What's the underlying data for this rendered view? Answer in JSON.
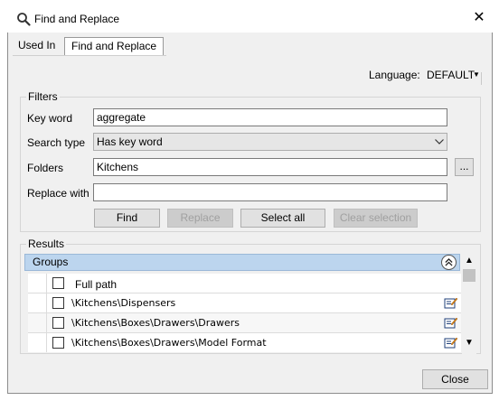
{
  "window": {
    "title": "Find and Replace",
    "close_glyph": "✕"
  },
  "tabs": [
    {
      "label": "Used In"
    },
    {
      "label": "Find and Replace"
    }
  ],
  "language": {
    "label": "Language:",
    "value": "DEFAULT"
  },
  "filters": {
    "group_label": "Filters",
    "key_word": {
      "label": "Key word",
      "value": "aggregate"
    },
    "search_type": {
      "label": "Search type",
      "value": "Has key word"
    },
    "folders": {
      "label": "Folders",
      "value": "Kitchens",
      "browse_label": "..."
    },
    "replace_with": {
      "label": "Replace with",
      "value": ""
    },
    "buttons": {
      "find": "Find",
      "replace": "Replace",
      "select_all": "Select all",
      "clear_selection": "Clear selection"
    }
  },
  "results": {
    "group_label": "Results",
    "grid_header": "Groups",
    "column_header": "Full path",
    "rows": [
      {
        "path": "\\Kitchens\\Dispensers"
      },
      {
        "path": "\\Kitchens\\Boxes\\Drawers\\Drawers"
      },
      {
        "path": "\\Kitchens\\Boxes\\Drawers\\Model Format"
      }
    ]
  },
  "footer": {
    "close_label": "Close"
  },
  "icons": {
    "title": "magnifier-icon",
    "row_action": "edit-icon"
  },
  "colors": {
    "grid_header_bg": "#bcd5ee",
    "window_bg": "#f0f0f0"
  }
}
